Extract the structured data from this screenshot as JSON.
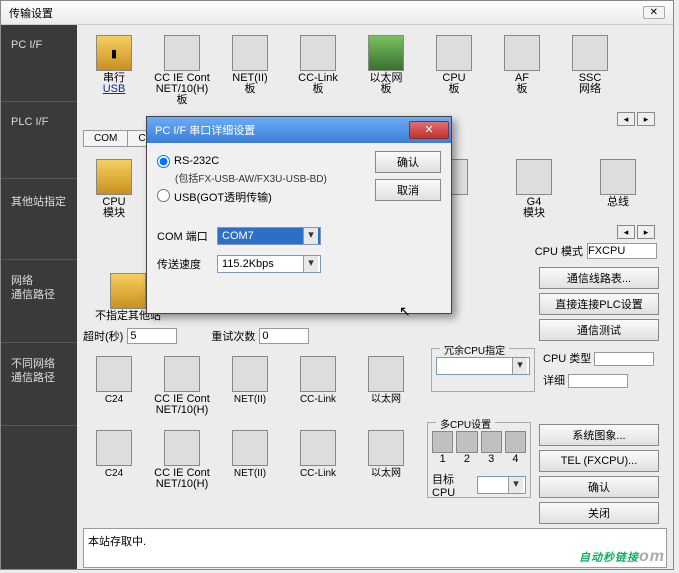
{
  "main_window": {
    "title": "传输设置",
    "close": "✕"
  },
  "sidebar": {
    "items": [
      {
        "label": "PC I/F"
      },
      {
        "label": "PLC I/F"
      },
      {
        "label": "其他站指定"
      },
      {
        "label_line1": "网络",
        "label_line2": "通信路径"
      },
      {
        "label_line1": "不同网络",
        "label_line2": "通信路径"
      }
    ]
  },
  "row1": {
    "items": [
      {
        "label_line1": "串行",
        "label_line2": "USB",
        "underline": true,
        "yellow": true
      },
      {
        "label_line1": "CC IE Cont",
        "label_line2": "NET/10(H)板"
      },
      {
        "label_line1": "NET(II)",
        "label_line2": "板"
      },
      {
        "label_line1": "CC-Link",
        "label_line2": "板"
      },
      {
        "label_line1": "以太网",
        "label_line2": "板",
        "green": true
      },
      {
        "label_line1": "CPU",
        "label_line2": "板"
      },
      {
        "label_line1": "AF",
        "label_line2": "板"
      },
      {
        "label_line1": "SSC",
        "label_line2": "网络"
      }
    ]
  },
  "subtabs": {
    "com": "COM",
    "com_val": "COM"
  },
  "row2": {
    "items": [
      {
        "label_line1": "CPU",
        "label_line2": "模块",
        "yellow": true
      },
      {
        "label_line1": "",
        "label_line2": ""
      },
      {
        "label_line1": "",
        "label_line2": ""
      },
      {
        "label_line1": "",
        "label_line2": ""
      },
      {
        "label_line1": "",
        "label_line2": ""
      },
      {
        "label_line1": "G4",
        "label_line2": "模块"
      },
      {
        "label_line1": "总线",
        "label_line2": ""
      }
    ]
  },
  "cpu_mode": {
    "label": "CPU 模式",
    "value": "FXCPU"
  },
  "row3_left": {
    "label": "不指定其他站",
    "yellow": true
  },
  "timeout": {
    "label": "超时(秒)",
    "value": "5",
    "retry_label": "重试次数",
    "retry_value": "0"
  },
  "right_buttons": {
    "route_table": "通信线路表...",
    "direct_plc": "直接连接PLC设置",
    "comm_test": "通信测试"
  },
  "row4": {
    "items": [
      {
        "label": "C24"
      },
      {
        "label_line1": "CC IE Cont",
        "label_line2": "NET/10(H)"
      },
      {
        "label": "NET(II)"
      },
      {
        "label": "CC-Link"
      },
      {
        "label": "以太网"
      }
    ]
  },
  "redundant_group": {
    "legend": "冗余CPU指定"
  },
  "cpu_type_label": "CPU 类型",
  "detail_label": "详细",
  "row5": {
    "items": [
      {
        "label": "C24"
      },
      {
        "label_line1": "CC IE Cont",
        "label_line2": "NET/10(H)"
      },
      {
        "label": "NET(II)"
      },
      {
        "label": "CC-Link"
      },
      {
        "label": "以太网"
      }
    ]
  },
  "multi_group": {
    "legend": "多CPU设置",
    "nums": [
      "1",
      "2",
      "3",
      "4"
    ],
    "target": "目标CPU"
  },
  "right_buttons2": {
    "sys_image": "系统图象...",
    "tel": "TEL (FXCPU)...",
    "ok": "确认",
    "close_btn": "关闭"
  },
  "status_text": "本站存取中.",
  "dialog": {
    "title": "PC I/F 串口详细设置",
    "radio_rs232": "RS-232C",
    "radio_sub": "(包括FX-USB-AW/FX3U-USB-BD)",
    "radio_usb": "USB(GOT透明传输)",
    "com_label": "COM 端口",
    "com_value": "COM7",
    "speed_label": "传送速度",
    "speed_value": "115.2Kbps",
    "ok": "确认",
    "cancel": "取消"
  },
  "watermark": {
    "main": "自动秒链接",
    "sub": "om"
  }
}
